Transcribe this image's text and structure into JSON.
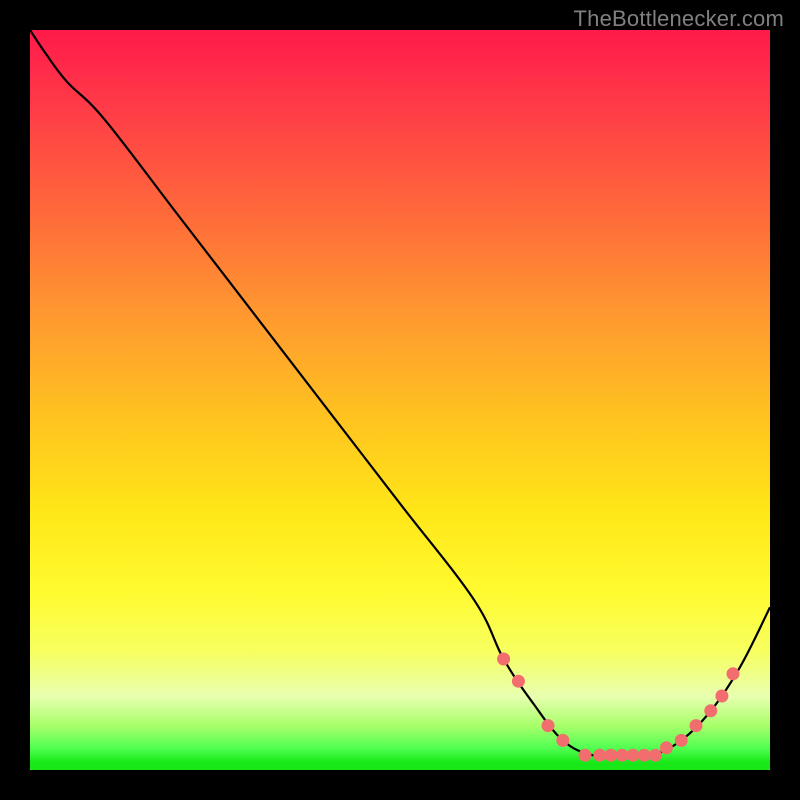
{
  "watermark": "TheBottlenecker.com",
  "colors": {
    "frame": "#000000",
    "curve": "#000000",
    "marker": "#f26d6d",
    "watermark": "#808080"
  },
  "chart_data": {
    "type": "line",
    "title": "",
    "xlabel": "",
    "ylabel": "",
    "xlim": [
      0,
      100
    ],
    "ylim": [
      0,
      100
    ],
    "grid": false,
    "legend": false,
    "series": [
      {
        "name": "bottleneck-curve",
        "x": [
          0,
          2,
          5,
          10,
          20,
          30,
          40,
          50,
          60,
          64,
          68,
          72,
          76,
          80,
          84,
          88,
          92,
          96,
          100
        ],
        "y": [
          100,
          97,
          93,
          88,
          75,
          62,
          49,
          36,
          23,
          15,
          9,
          4,
          2,
          2,
          2,
          4,
          8,
          14,
          22
        ]
      }
    ],
    "markers": [
      {
        "x": 64,
        "y": 15
      },
      {
        "x": 66,
        "y": 12
      },
      {
        "x": 70,
        "y": 6
      },
      {
        "x": 72,
        "y": 4
      },
      {
        "x": 75,
        "y": 2
      },
      {
        "x": 77,
        "y": 2
      },
      {
        "x": 78.5,
        "y": 2
      },
      {
        "x": 80,
        "y": 2
      },
      {
        "x": 81.5,
        "y": 2
      },
      {
        "x": 83,
        "y": 2
      },
      {
        "x": 84.5,
        "y": 2
      },
      {
        "x": 86,
        "y": 3
      },
      {
        "x": 88,
        "y": 4
      },
      {
        "x": 90,
        "y": 6
      },
      {
        "x": 92,
        "y": 8
      },
      {
        "x": 93.5,
        "y": 10
      },
      {
        "x": 95,
        "y": 13
      }
    ]
  }
}
